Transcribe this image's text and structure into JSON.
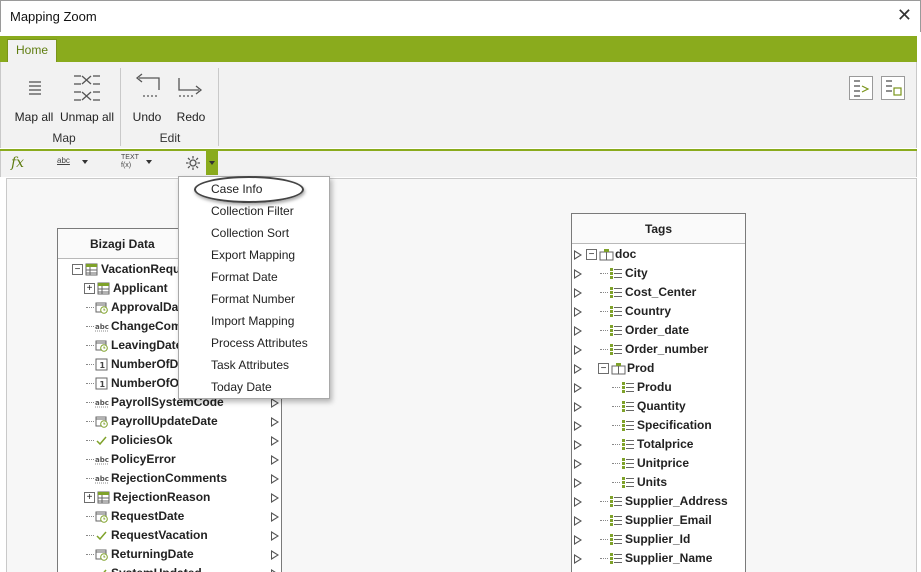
{
  "window": {
    "title": "Mapping Zoom",
    "close_glyph": "✕"
  },
  "ribbon": {
    "tab": "Home",
    "groups": [
      {
        "label": "Map",
        "buttons": [
          {
            "label": "Map all",
            "icon": "map-all-icon"
          },
          {
            "label": "Unmap all",
            "icon": "unmap-all-icon"
          }
        ]
      },
      {
        "label": "Edit",
        "buttons": [
          {
            "label": "Undo",
            "icon": "undo-icon"
          },
          {
            "label": "Redo",
            "icon": "redo-icon"
          }
        ]
      }
    ]
  },
  "formula_bar": {
    "fx": "fx",
    "items": [
      {
        "label": "abc",
        "icon": "text-function-icon"
      },
      {
        "label": "TEXT f(x)",
        "icon": "text-fx-icon"
      },
      {
        "label": "",
        "icon": "gear-icon"
      }
    ]
  },
  "dropdown": {
    "items": [
      "Case Info",
      "Collection Filter",
      "Collection Sort",
      "Export Mapping",
      "Format Date",
      "Format Number",
      "Import Mapping",
      "Process Attributes",
      "Task Attributes",
      "Today Date"
    ],
    "highlighted": "Case Info"
  },
  "bizagi": {
    "header": "Bizagi Data",
    "rows": [
      {
        "label": "VacationRequ",
        "icon": "table-icon",
        "expander": "−"
      },
      {
        "label": "Applicant",
        "icon": "table-icon",
        "expander": "+"
      },
      {
        "label": "ApprovalDate",
        "icon": "date-icon"
      },
      {
        "label": "ChangeComm",
        "icon": "text-icon"
      },
      {
        "label": "LeavingDate",
        "icon": "date-icon"
      },
      {
        "label": "NumberOfDa",
        "icon": "number-icon"
      },
      {
        "label": "NumberOfOff",
        "icon": "number-icon"
      },
      {
        "label": "PayrollSystemCode",
        "icon": "text-icon"
      },
      {
        "label": "PayrollUpdateDate",
        "icon": "date-icon"
      },
      {
        "label": "PoliciesOk",
        "icon": "boolean-icon"
      },
      {
        "label": "PolicyError",
        "icon": "text-icon"
      },
      {
        "label": "RejectionComments",
        "icon": "text-icon"
      },
      {
        "label": "RejectionReason",
        "icon": "table-icon",
        "expander": "+"
      },
      {
        "label": "RequestDate",
        "icon": "date-icon"
      },
      {
        "label": "RequestVacation",
        "icon": "boolean-icon"
      },
      {
        "label": "ReturningDate",
        "icon": "date-icon"
      },
      {
        "label": "SystemUpdated",
        "icon": "boolean-icon"
      }
    ]
  },
  "tags": {
    "header": "Tags",
    "rows": [
      {
        "label": "doc",
        "icon": "folder-node-icon",
        "expander": "−"
      },
      {
        "label": "City",
        "icon": "element-icon"
      },
      {
        "label": "Cost_Center",
        "icon": "element-icon"
      },
      {
        "label": "Country",
        "icon": "element-icon"
      },
      {
        "label": "Order_date",
        "icon": "element-icon"
      },
      {
        "label": "Order_number",
        "icon": "element-icon"
      },
      {
        "label": "Prod",
        "icon": "folder-node-icon",
        "expander": "−"
      },
      {
        "label": "Produ",
        "icon": "element-icon"
      },
      {
        "label": "Quantity",
        "icon": "element-icon"
      },
      {
        "label": "Specification",
        "icon": "element-icon"
      },
      {
        "label": "Totalprice",
        "icon": "element-icon"
      },
      {
        "label": "Unitprice",
        "icon": "element-icon"
      },
      {
        "label": "Units",
        "icon": "element-icon"
      },
      {
        "label": "Supplier_Address",
        "icon": "element-icon"
      },
      {
        "label": "Supplier_Email",
        "icon": "element-icon"
      },
      {
        "label": "Supplier_Id",
        "icon": "element-icon"
      },
      {
        "label": "Supplier_Name",
        "icon": "element-icon"
      }
    ]
  },
  "colors": {
    "accent": "#8aab1d",
    "accent_dark": "#5f7d10"
  }
}
